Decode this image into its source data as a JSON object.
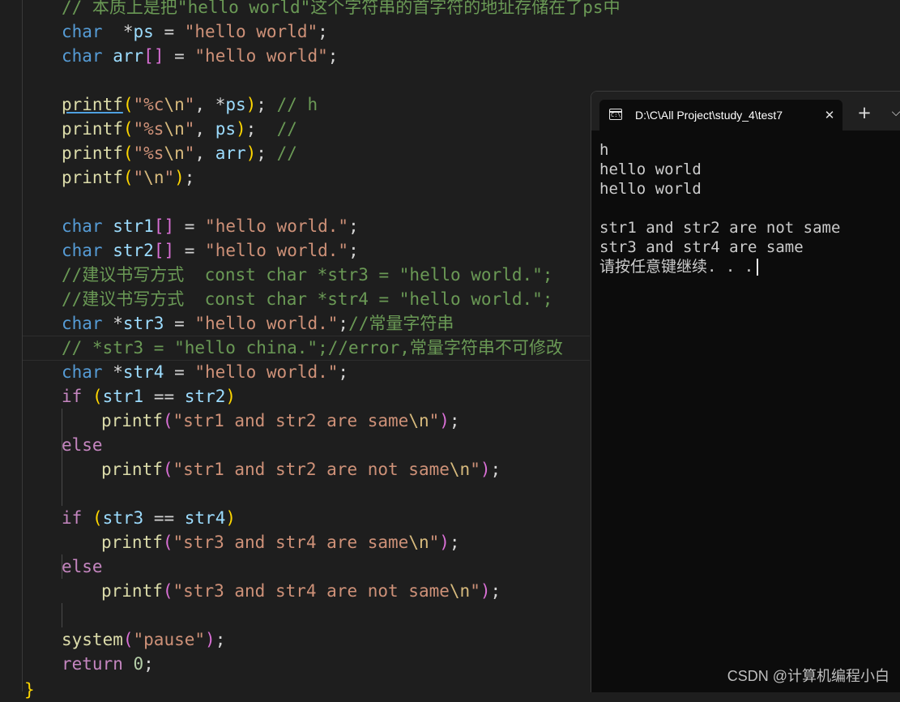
{
  "editor": {
    "lines": [
      {
        "t": [
          [
            "cmt",
            "// 本质上是把\"hello world\"这个字符串的首字符的地址存储在了ps中"
          ]
        ]
      },
      {
        "t": [
          [
            "kw",
            "char"
          ],
          [
            "",
            "  "
          ],
          [
            "",
            "*"
          ],
          [
            "var",
            "ps"
          ],
          [
            "",
            " = "
          ],
          [
            "str",
            "\"hello world\""
          ],
          [
            "",
            ";"
          ]
        ]
      },
      {
        "t": [
          [
            "kw",
            "char"
          ],
          [
            "",
            " "
          ],
          [
            "var",
            "arr"
          ],
          [
            "p2",
            "[]"
          ],
          [
            "",
            " = "
          ],
          [
            "str",
            "\"hello world\""
          ],
          [
            "",
            ";"
          ]
        ]
      },
      {
        "t": []
      },
      {
        "t": [
          [
            "fn ul",
            "printf"
          ],
          [
            "p1",
            "("
          ],
          [
            "str",
            "\"%c"
          ],
          [
            "esc",
            "\\n"
          ],
          [
            "str",
            "\""
          ],
          [
            "",
            ", *"
          ],
          [
            "var",
            "ps"
          ],
          [
            "p1",
            ")"
          ],
          [
            "",
            ";"
          ],
          [
            "",
            " "
          ],
          [
            "cmt",
            "// h"
          ]
        ]
      },
      {
        "t": [
          [
            "fn",
            "printf"
          ],
          [
            "p1",
            "("
          ],
          [
            "str",
            "\"%s"
          ],
          [
            "esc",
            "\\n"
          ],
          [
            "str",
            "\""
          ],
          [
            "",
            ", "
          ],
          [
            "var",
            "ps"
          ],
          [
            "p1",
            ")"
          ],
          [
            "",
            ";"
          ],
          [
            "",
            "  "
          ],
          [
            "cmt",
            "//"
          ]
        ]
      },
      {
        "t": [
          [
            "fn",
            "printf"
          ],
          [
            "p1",
            "("
          ],
          [
            "str",
            "\"%s"
          ],
          [
            "esc",
            "\\n"
          ],
          [
            "str",
            "\""
          ],
          [
            "",
            ", "
          ],
          [
            "var",
            "arr"
          ],
          [
            "p1",
            ")"
          ],
          [
            "",
            ";"
          ],
          [
            "",
            " "
          ],
          [
            "cmt",
            "//"
          ]
        ]
      },
      {
        "t": [
          [
            "fn",
            "printf"
          ],
          [
            "p1",
            "("
          ],
          [
            "str",
            "\""
          ],
          [
            "esc",
            "\\n"
          ],
          [
            "str",
            "\""
          ],
          [
            "p1",
            ")"
          ],
          [
            "",
            ";"
          ]
        ]
      },
      {
        "t": []
      },
      {
        "t": [
          [
            "kw",
            "char"
          ],
          [
            "",
            " "
          ],
          [
            "var",
            "str1"
          ],
          [
            "p2",
            "[]"
          ],
          [
            "",
            " = "
          ],
          [
            "str",
            "\"hello world.\""
          ],
          [
            "",
            ";"
          ]
        ]
      },
      {
        "t": [
          [
            "kw",
            "char"
          ],
          [
            "",
            " "
          ],
          [
            "var",
            "str2"
          ],
          [
            "p2",
            "[]"
          ],
          [
            "",
            " = "
          ],
          [
            "str",
            "\"hello world.\""
          ],
          [
            "",
            ";"
          ]
        ]
      },
      {
        "t": [
          [
            "cmt",
            "//建议书写方式  const char *str3 = \"hello world.\";"
          ]
        ]
      },
      {
        "t": [
          [
            "cmt",
            "//建议书写方式  const char *str4 = \"hello world.\";"
          ]
        ]
      },
      {
        "t": [
          [
            "kw",
            "char"
          ],
          [
            "",
            " *"
          ],
          [
            "var",
            "str3"
          ],
          [
            "",
            " = "
          ],
          [
            "str",
            "\"hello world.\""
          ],
          [
            "",
            ";"
          ],
          [
            "cmt",
            "//常量字符串"
          ]
        ]
      },
      {
        "t": [
          [
            "cmt",
            "// *str3 = \"hello china.\";//error,常量字符串不可修改"
          ]
        ]
      },
      {
        "t": [
          [
            "kw",
            "char"
          ],
          [
            "",
            " *"
          ],
          [
            "var",
            "str4"
          ],
          [
            "",
            " = "
          ],
          [
            "str",
            "\"hello world.\""
          ],
          [
            "",
            ";"
          ]
        ]
      },
      {
        "t": [
          [
            "ctl",
            "if"
          ],
          [
            "",
            " "
          ],
          [
            "p1",
            "("
          ],
          [
            "var",
            "str1"
          ],
          [
            "",
            " == "
          ],
          [
            "var",
            "str2"
          ],
          [
            "p1",
            ")"
          ]
        ]
      },
      {
        "indent": true,
        "t": [
          [
            "fn",
            "printf"
          ],
          [
            "p2",
            "("
          ],
          [
            "str",
            "\"str1 and str2 are same"
          ],
          [
            "esc",
            "\\n"
          ],
          [
            "str",
            "\""
          ],
          [
            "p2",
            ")"
          ],
          [
            "",
            ";"
          ]
        ]
      },
      {
        "t": [
          [
            "ctl",
            "else"
          ]
        ]
      },
      {
        "indent": true,
        "t": [
          [
            "fn",
            "printf"
          ],
          [
            "p2",
            "("
          ],
          [
            "str",
            "\"str1 and str2 are not same"
          ],
          [
            "esc",
            "\\n"
          ],
          [
            "str",
            "\""
          ],
          [
            "p2",
            ")"
          ],
          [
            "",
            ";"
          ]
        ]
      },
      {
        "t": []
      },
      {
        "t": [
          [
            "ctl",
            "if"
          ],
          [
            "",
            " "
          ],
          [
            "p1",
            "("
          ],
          [
            "var",
            "str3"
          ],
          [
            "",
            " == "
          ],
          [
            "var",
            "str4"
          ],
          [
            "p1",
            ")"
          ]
        ]
      },
      {
        "indent": true,
        "t": [
          [
            "fn",
            "printf"
          ],
          [
            "p2",
            "("
          ],
          [
            "str",
            "\"str3 and str4 are same"
          ],
          [
            "esc",
            "\\n"
          ],
          [
            "str",
            "\""
          ],
          [
            "p2",
            ")"
          ],
          [
            "",
            ";"
          ]
        ]
      },
      {
        "t": [
          [
            "ctl",
            "else"
          ]
        ]
      },
      {
        "indent": true,
        "t": [
          [
            "fn",
            "printf"
          ],
          [
            "p2",
            "("
          ],
          [
            "str",
            "\"str3 and str4 are not same"
          ],
          [
            "esc",
            "\\n"
          ],
          [
            "str",
            "\""
          ],
          [
            "p2",
            ")"
          ],
          [
            "",
            ";"
          ]
        ]
      },
      {
        "t": []
      },
      {
        "t": [
          [
            "fn",
            "system"
          ],
          [
            "p2",
            "("
          ],
          [
            "str",
            "\"pause\""
          ],
          [
            "p2",
            ")"
          ],
          [
            "",
            ";"
          ]
        ]
      },
      {
        "t": [
          [
            "ctl",
            "return"
          ],
          [
            "",
            " "
          ],
          [
            "num",
            "0"
          ],
          [
            "",
            ";"
          ]
        ]
      }
    ],
    "closing_brace": "}"
  },
  "terminal": {
    "tab_title": "D:\\C\\All Project\\study_4\\test7",
    "tab_icon_glyph": "C:\\",
    "close_glyph": "✕",
    "new_tab_glyph": "+",
    "dropdown_glyph": "⌵",
    "output": [
      "h",
      "hello world",
      "hello world",
      "",
      "str1 and str2 are not same",
      "str3 and str4 are same",
      "请按任意键继续. . ."
    ]
  },
  "watermark": "CSDN @计算机编程小白"
}
